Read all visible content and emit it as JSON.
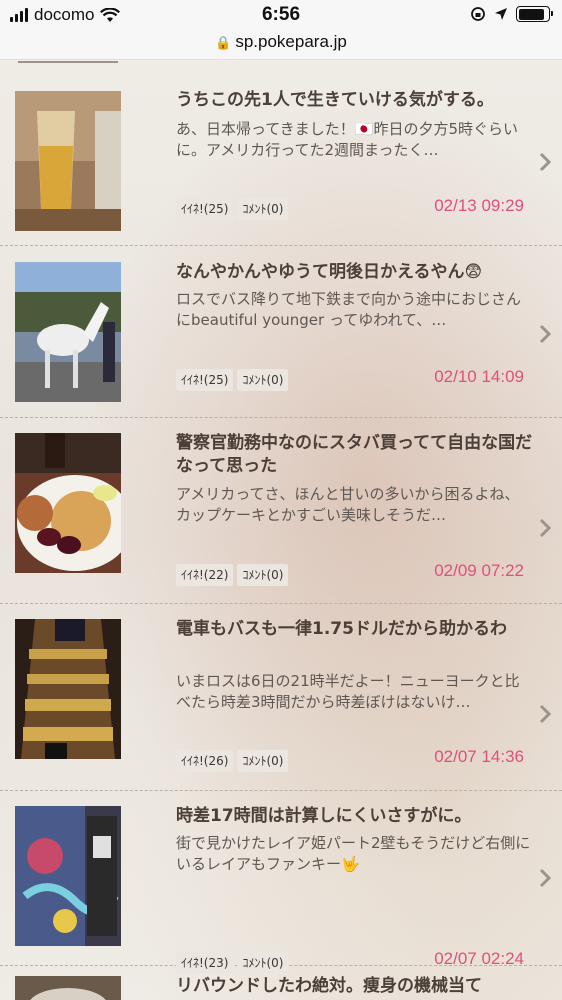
{
  "status_bar": {
    "carrier": "docomo",
    "time": "6:56"
  },
  "url_bar": {
    "domain": "sp.pokepara.jp"
  },
  "posts": [
    {
      "title": "うちこの先1人で生きていける気がする。",
      "excerpt": "あ、日本帰ってきました！🇯🇵昨日の夕方5時ぐらいに。アメリカ行ってた2週間まったく…",
      "likes": "ｲｲﾈ!(25)",
      "comments": "ｺﾒﾝﾄ(0)",
      "date": "02/13 09:29",
      "thumb_icon": "beer-glass-photo"
    },
    {
      "title": "なんやかんやゆうて明後日かえるやん😨",
      "excerpt": "ロスでバス降りて地下鉄まで向かう途中におじさんにbeautiful younger ってゆわれて、…",
      "likes": "ｲｲﾈ!(25)",
      "comments": "ｺﾒﾝﾄ(0)",
      "date": "02/10 14:09",
      "thumb_icon": "white-horse-photo"
    },
    {
      "title": "警察官勤務中なのにスタバ買ってて自由な国だなって思った",
      "excerpt": "アメリカってさ、ほんと甘いの多いから困るよね、カップケーキとかすごい美味しそうだ…",
      "likes": "ｲｲﾈ!(22)",
      "comments": "ｺﾒﾝﾄ(0)",
      "date": "02/09 07:22",
      "thumb_icon": "waffle-plate-photo"
    },
    {
      "title": "電車もバスも一律1.75ドルだから助かるわ",
      "excerpt": "いまロスは6日の21時半だよー！ニューヨークと比べたら時差3時間だから時差ぼけはないけ…",
      "likes": "ｲｲﾈ!(26)",
      "comments": "ｺﾒﾝﾄ(0)",
      "date": "02/07 14:36",
      "thumb_icon": "escalator-photo"
    },
    {
      "title": "時差17時間は計算しにくいさすがに。",
      "excerpt": "街で見かけたレイア姫パート2壁もそうだけど右側にいるレイアもファンキー🤟",
      "likes": "ｲｲﾈ!(23)",
      "comments": "ｺﾒﾝﾄ(0)",
      "date": "02/07 02:24",
      "thumb_icon": "graffiti-wall-photo"
    },
    {
      "title": "リバウンドしたわ絶対。痩身の機械当て"
    }
  ],
  "colors": {
    "accent_date": "#e0507d",
    "title": "#4b3f37"
  }
}
